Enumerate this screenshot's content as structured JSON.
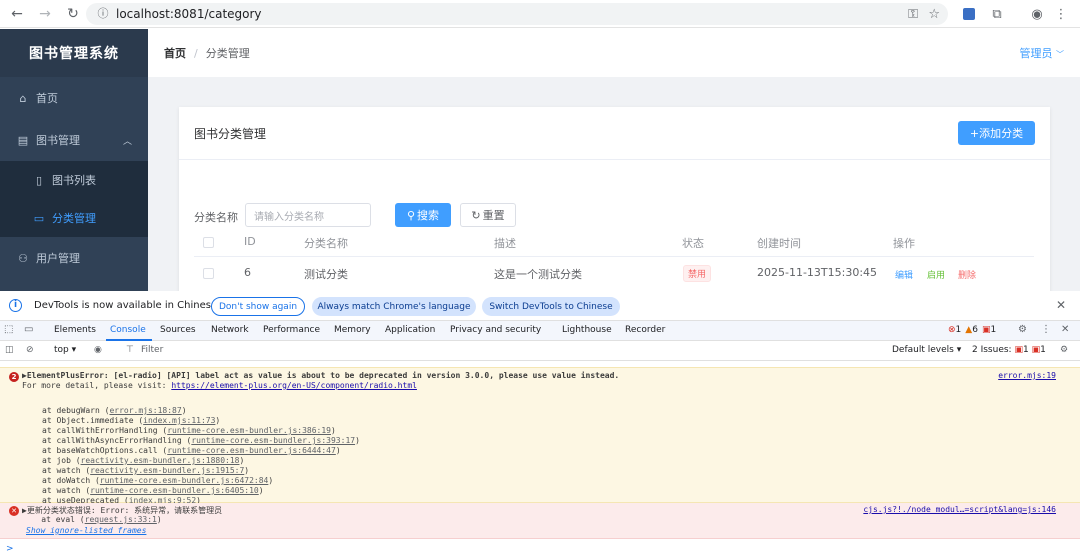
{
  "browser": {
    "url": "localhost:8081/category"
  },
  "sidebar": {
    "title": "图书管理系统",
    "items": [
      {
        "label": "首页"
      },
      {
        "label": "图书管理"
      },
      {
        "label": "图书列表"
      },
      {
        "label": "分类管理"
      },
      {
        "label": "用户管理"
      }
    ]
  },
  "header": {
    "breadcrumb_home": "首页",
    "breadcrumb_sep": "/",
    "breadcrumb_current": "分类管理",
    "user": "管理员"
  },
  "card": {
    "title": "图书分类管理",
    "add_button": "+添加分类",
    "search_label": "分类名称",
    "search_placeholder": "请输入分类名称",
    "search_button": "搜索",
    "reset_button": "重置"
  },
  "table": {
    "headers": [
      "ID",
      "分类名称",
      "描述",
      "状态",
      "创建时间",
      "操作"
    ],
    "rows": [
      {
        "id": "6",
        "name": "测试分类",
        "desc": "这是一个测试分类",
        "status": "禁用",
        "created": "2025-11-13T15:30:45",
        "op_edit": "编辑",
        "op_enable": "启用",
        "op_delete": "删除"
      }
    ]
  },
  "devtools": {
    "infobar_text": "DevTools is now available in Chinese",
    "btn_dont_show": "Don't show again",
    "btn_match": "Always match Chrome's language",
    "btn_switch": "Switch DevTools to Chinese",
    "tabs": [
      "Elements",
      "Console",
      "Sources",
      "Network",
      "Performance",
      "Memory",
      "Application",
      "Privacy and security",
      "Lighthouse",
      "Recorder"
    ],
    "counts": {
      "errors": "1",
      "warnings": "6",
      "issues": "1"
    },
    "context": "top",
    "filter_placeholder": "Filter",
    "levels": "Default levels",
    "issues_label": "2 Issues:",
    "issues_err": "1",
    "issues_warn": "1"
  },
  "console": {
    "warn_line1": "▶ElementPlusError: [el-radio] [API] label act as value is about to be deprecated in version 3.0.0, please use value instead.",
    "warn_line2_prefix": "For more detail, please visit: ",
    "warn_link": "https://element-plus.org/en-US/component/radio.html",
    "warn_source": "error.mjs:19",
    "stack": [
      {
        "fn": "at debugWarn (",
        "loc": "error.mjs:18:87",
        "end": ")"
      },
      {
        "fn": "at Object.immediate (",
        "loc": "index.mjs:11:73",
        "end": ")"
      },
      {
        "fn": "at callWithErrorHandling (",
        "loc": "runtime-core.esm-bundler.js:386:19",
        "end": ")"
      },
      {
        "fn": "at callWithAsyncErrorHandling (",
        "loc": "runtime-core.esm-bundler.js:393:17",
        "end": ")"
      },
      {
        "fn": "at baseWatchOptions.call (",
        "loc": "runtime-core.esm-bundler.js:6444:47",
        "end": ")"
      },
      {
        "fn": "at job (",
        "loc": "reactivity.esm-bundler.js:1880:18",
        "end": ")"
      },
      {
        "fn": "at watch (",
        "loc": "reactivity.esm-bundler.js:1915:7",
        "end": ")"
      },
      {
        "fn": "at doWatch (",
        "loc": "runtime-core.esm-bundler.js:6472:84",
        "end": ")"
      },
      {
        "fn": "at watch (",
        "loc": "runtime-core.esm-bundler.js:6405:10",
        "end": ")"
      },
      {
        "fn": "at useDeprecated (",
        "loc": "index.mjs:9:52",
        "end": ")"
      }
    ],
    "err_line1": "▶更新分类状态错误: Error: 系统异常，请联系管理员",
    "err_line2_prefix": "    at eval (",
    "err_line2_link": "request.js:33:1",
    "err_line2_end": ")",
    "err_show": "Show ignore-listed frames",
    "err_source": "cjs.js?!./node_modul…=script&lang=js:146",
    "prompt": ">"
  },
  "colors": {
    "primary": "#409eff",
    "sidebar_bg": "#304156",
    "danger": "#f56c6c",
    "success": "#67c23a"
  }
}
